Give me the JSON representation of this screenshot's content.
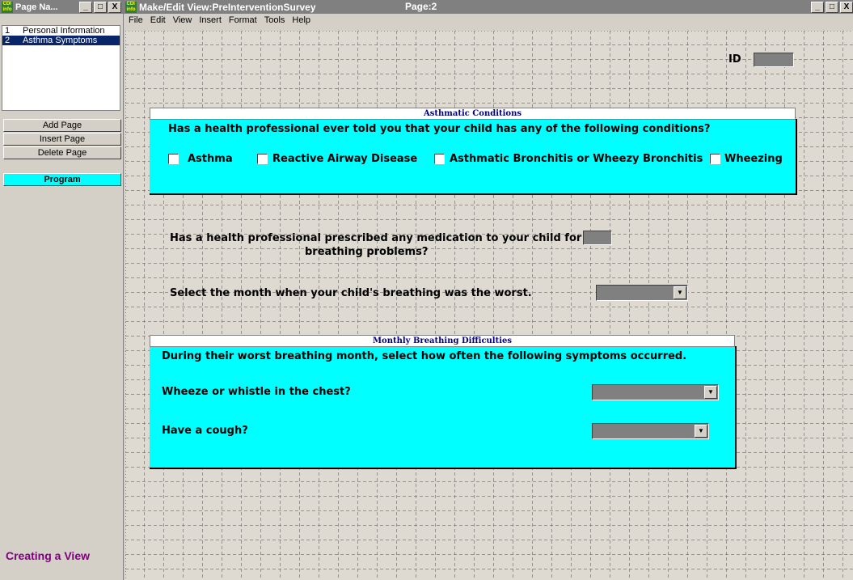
{
  "page_list_window": {
    "title": "Page Na...",
    "controls": [
      "_",
      "□",
      "X"
    ],
    "pages": [
      {
        "num": "1",
        "name": "Personal Information"
      },
      {
        "num": "2",
        "name": "Asthma Symptoms"
      }
    ],
    "buttons": {
      "add": "Add Page",
      "insert": "Insert Page",
      "delete": "Delete Page",
      "program": "Program"
    },
    "status": "Creating a View"
  },
  "main_window": {
    "title": "Make/Edit View:PreInterventionSurvey",
    "page": "Page:2",
    "controls": [
      "_",
      "□",
      "X"
    ],
    "menu": [
      "File",
      "Edit",
      "View",
      "Insert",
      "Format",
      "Tools",
      "Help"
    ]
  },
  "form": {
    "id_label": "ID",
    "asthmatic": {
      "header": "Asthmatic Conditions",
      "question": "Has a health professional ever told you that your child has any of the following conditions?",
      "options": [
        "Asthma",
        "Reactive Airway Disease",
        "Asthmatic Bronchitis or Wheezy Bronchitis",
        "Wheezing"
      ]
    },
    "medication_question_line1": "Has a health professional prescribed any medication to your child for",
    "medication_question_line2": "breathing problems?",
    "month_question": "Select the month when your child's breathing was the worst.",
    "monthly": {
      "header": "Monthly Breathing Difficulties",
      "intro": "During their worst breathing month, select how often the following symptoms occurred.",
      "q_wheeze": "Wheeze or whistle in the chest?",
      "q_cough": "Have a cough?"
    }
  },
  "colors": {
    "group_bg": "#00ffff",
    "header_text": "#000080",
    "status_text": "#800080",
    "titlebar": "#808080"
  }
}
